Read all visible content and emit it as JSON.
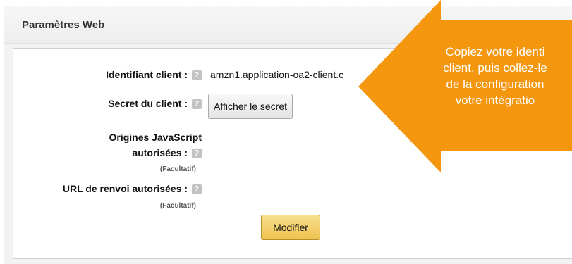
{
  "panel": {
    "title": "Paramètres Web"
  },
  "fields": {
    "client_id": {
      "label": "Identifiant client :",
      "value": "amzn1.application-oa2-client.c"
    },
    "client_secret": {
      "label": "Secret du client :",
      "button_label": "Afficher le secret"
    },
    "js_origins": {
      "label_line1": "Origines JavaScript",
      "label_line2": "autorisées :",
      "optional": "(Facultatif)"
    },
    "return_urls": {
      "label": "URL de renvoi autorisées :",
      "optional": "(Facultatif)"
    }
  },
  "help_icon_glyph": "?",
  "modify_button_label": "Modifier",
  "callout": {
    "line1": "Copiez votre identi",
    "line2": "client, puis collez-le",
    "line3": "de la configuration",
    "line4": "votre intégratio",
    "color": "#f5960f"
  },
  "colors": {
    "primary_button": "#eec24f",
    "help_icon": "#c3c3c3"
  }
}
